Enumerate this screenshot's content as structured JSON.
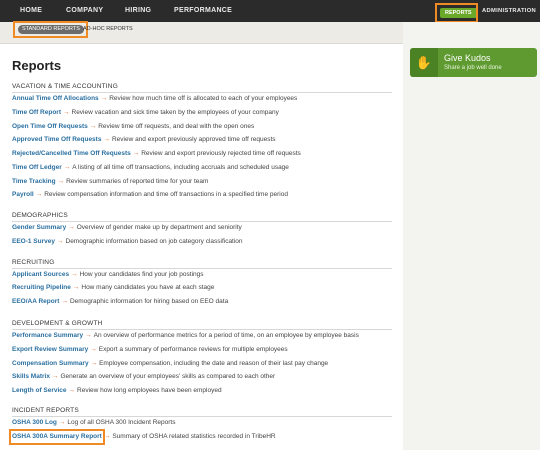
{
  "nav": {
    "items": [
      "HOME",
      "COMPANY",
      "HIRING",
      "PERFORMANCE"
    ],
    "reports_label": "REPORTS",
    "admin_label": "ADMINISTRATION"
  },
  "subnav": {
    "standard": "STANDARD REPORTS",
    "adhoc": "AD-HOC REPORTS"
  },
  "kudos": {
    "icon": "thumbs-up-icon",
    "title": "Give Kudos",
    "subtitle": "Share a job well done"
  },
  "page": {
    "title": "Reports"
  },
  "colors": {
    "accent_green": "#6aa82a",
    "highlight_orange": "#f08a24",
    "link_blue": "#2a6fa0"
  },
  "sections": [
    {
      "title": "VACATION & TIME ACCOUNTING",
      "rows": [
        {
          "name": "Annual Time Off Allocations",
          "desc": "Review how much time off is allocated to each of your employees"
        },
        {
          "name": "Time Off Report",
          "desc": "Review vacation and sick time taken by the employees of your company"
        },
        {
          "name": "Open Time Off Requests",
          "desc": "Review time off requests, and deal with the open ones"
        },
        {
          "name": "Approved Time Off Requests",
          "desc": "Review and export previously approved time off requests"
        },
        {
          "name": "Rejected/Cancelled Time Off Requests",
          "desc": "Review and export previously rejected time off requests"
        },
        {
          "name": "Time Off Ledger",
          "desc": "A listing of all time off transactions, including accruals and scheduled usage"
        },
        {
          "name": "Time Tracking",
          "desc": "Review summaries of reported time for your team"
        },
        {
          "name": "Payroll",
          "desc": "Review compensation information and time off transactions in a specified time period"
        }
      ]
    },
    {
      "title": "DEMOGRAPHICS",
      "rows": [
        {
          "name": "Gender Summary",
          "desc": "Overview of gender make up by department and seniority"
        },
        {
          "name": "EEO-1 Survey",
          "desc": "Demographic information based on job category classification"
        }
      ]
    },
    {
      "title": "RECRUITING",
      "rows": [
        {
          "name": "Applicant Sources",
          "desc": "How your candidates find your job postings"
        },
        {
          "name": "Recruiting Pipeline",
          "desc": "How many candidates you have at each stage"
        },
        {
          "name": "EEO/AA Report",
          "desc": "Demographic information for hiring based on EEO data"
        }
      ]
    },
    {
      "title": "DEVELOPMENT & GROWTH",
      "rows": [
        {
          "name": "Performance Summary",
          "desc": "An overview of performance metrics for a period of time, on an employee by employee basis"
        },
        {
          "name": "Export Review Summary",
          "desc": "Export a summary of performance reviews for multiple employees"
        },
        {
          "name": "Compensation Summary",
          "desc": "Employee compensation, including the date and reason of their last pay change"
        },
        {
          "name": "Skills Matrix",
          "desc": "Generate an overview of your employees' skills as compared to each other"
        },
        {
          "name": "Length of Service",
          "desc": "Review how long employees have been employed"
        }
      ]
    },
    {
      "title": "INCIDENT REPORTS",
      "rows": [
        {
          "name": "OSHA 300 Log",
          "desc": "Log of all OSHA 300 Incident Reports"
        },
        {
          "name": "OSHA 300A Summary Report",
          "desc": "Summary of OSHA related statistics recorded in TribeHR"
        }
      ]
    }
  ]
}
